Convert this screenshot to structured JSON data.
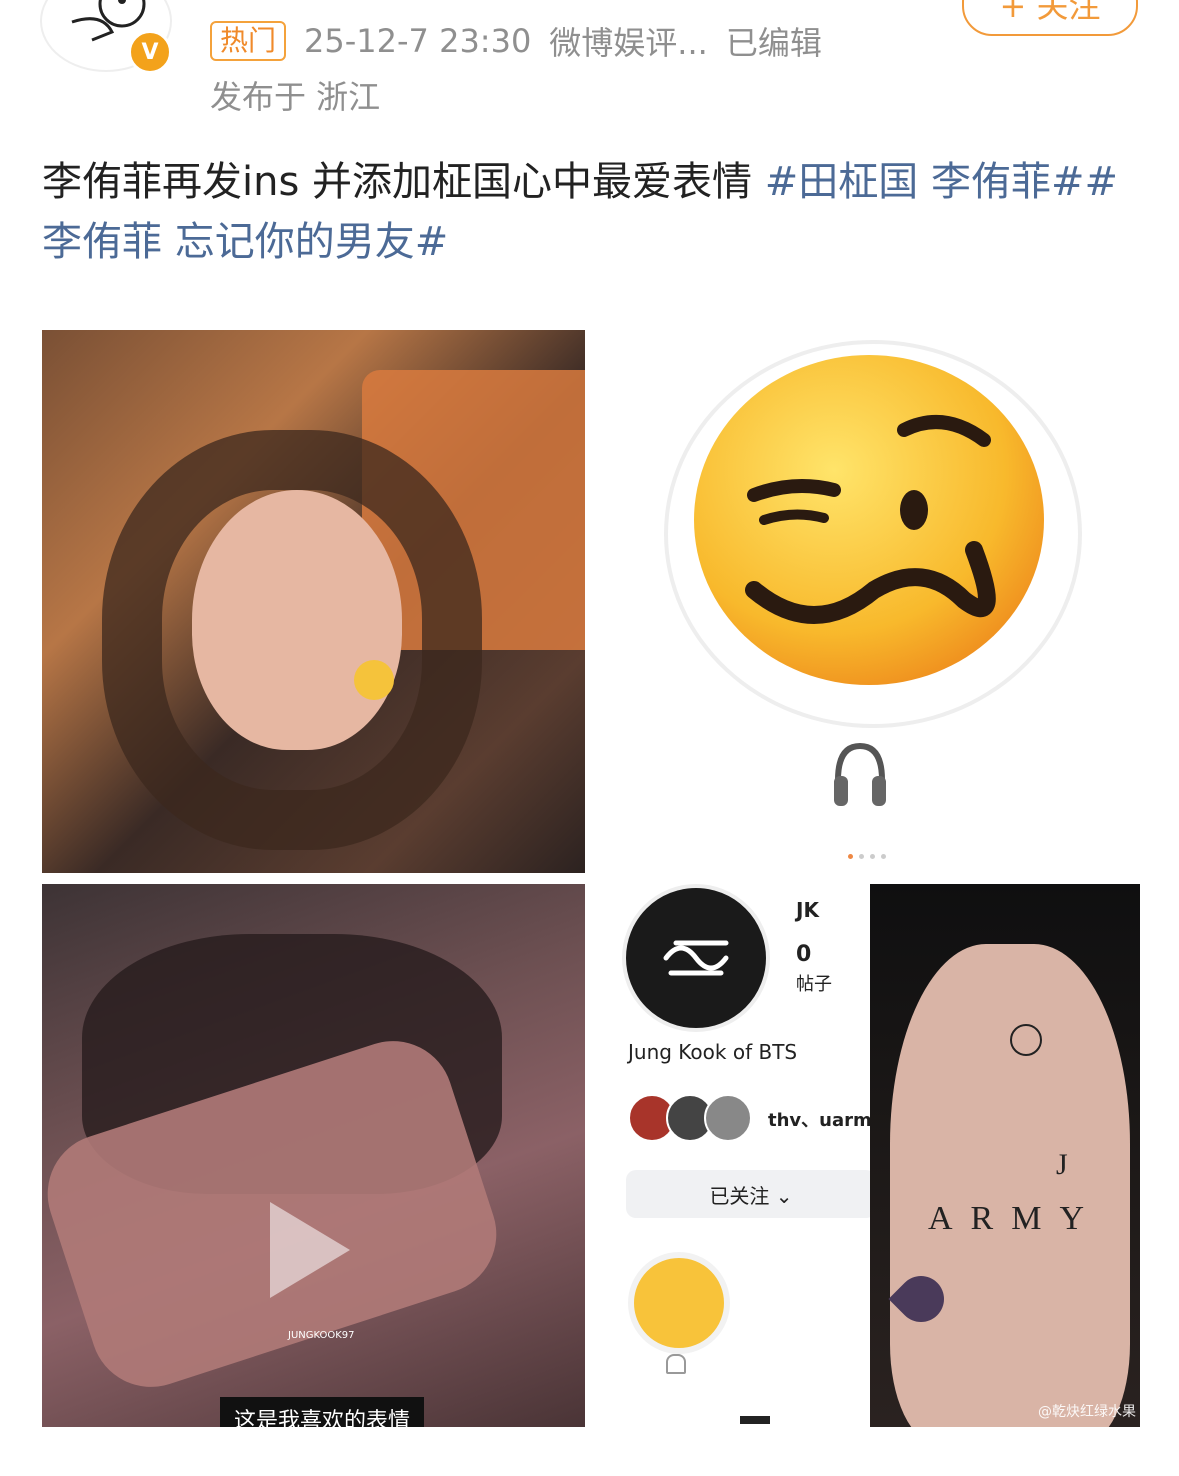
{
  "header": {
    "hot_tag": "热门",
    "timestamp": "25-12-7 23:30",
    "source": "微博娱评...",
    "edited": "已编辑",
    "location": "发布于 浙江",
    "follow_label": "+ 关注"
  },
  "post": {
    "text_main": "李侑菲再发ins 并添加柾国心中最爱表情 ",
    "topic_1": "#田柾国 李侑菲#",
    "topic_2": "#李侑菲 忘记你的男友#"
  },
  "images": {
    "video_subtitle": "这是我喜欢的表情",
    "video_caption": "JUNGKOOK97",
    "profile_name": "JK",
    "profile_posts_count": "0",
    "profile_posts_label": "帖子",
    "profile_fullname": "Jung Kook of BTS",
    "profile_followed_by": "thv、uarm",
    "profile_follow_state": "已关注 ⌄",
    "hand_text": "ARMY",
    "hand_letter": "J",
    "watermark": "@乾炔红绿水果"
  },
  "colors": {
    "accent": "#f29a3a",
    "topic": "#4c6a96",
    "meta": "#8f8f8f"
  }
}
